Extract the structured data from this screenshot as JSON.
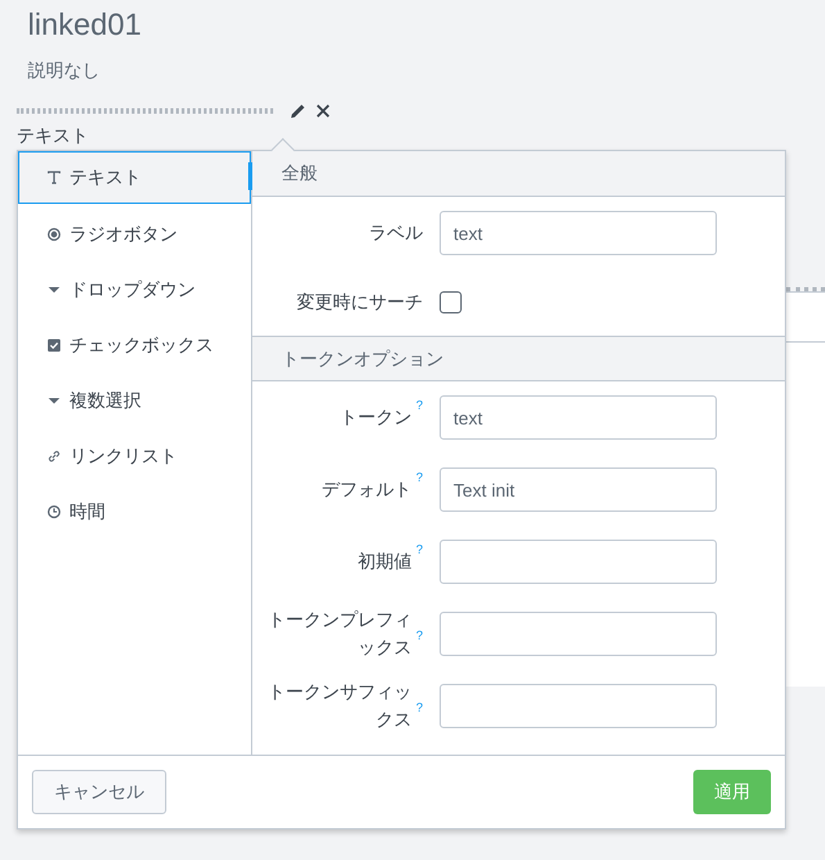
{
  "page": {
    "title": "linked01",
    "description": "説明なし",
    "input_label": "テキスト"
  },
  "popup": {
    "types": [
      {
        "kind": "text",
        "label": "テキスト",
        "selected": true
      },
      {
        "kind": "radio",
        "label": "ラジオボタン",
        "selected": false
      },
      {
        "kind": "dropdown",
        "label": "ドロップダウン",
        "selected": false
      },
      {
        "kind": "checkbox",
        "label": "チェックボックス",
        "selected": false
      },
      {
        "kind": "multiselect",
        "label": "複数選択",
        "selected": false
      },
      {
        "kind": "link",
        "label": "リンクリスト",
        "selected": false
      },
      {
        "kind": "time",
        "label": "時間",
        "selected": false
      }
    ],
    "sections": [
      {
        "title": "全般",
        "fields": [
          {
            "kind": "text",
            "label": "ラベル",
            "value": "text"
          },
          {
            "kind": "checkbox",
            "label": "変更時にサーチ",
            "checked": false
          }
        ]
      },
      {
        "title": "トークンオプション",
        "fields": [
          {
            "kind": "text",
            "label": "トークン",
            "help": "?",
            "value": "text"
          },
          {
            "kind": "text",
            "label": "デフォルト",
            "help": "?",
            "value": "Text init"
          },
          {
            "kind": "text",
            "label": "初期値",
            "help": "?"
          },
          {
            "kind": "text",
            "label": "トークンプレフィックス",
            "help": "?"
          },
          {
            "kind": "text",
            "label": "トークンサフィックス",
            "help": "?"
          }
        ]
      }
    ],
    "buttons": [
      {
        "kind": "secondary",
        "label": "キャンセル"
      },
      {
        "kind": "primary",
        "label": "適用"
      }
    ]
  }
}
